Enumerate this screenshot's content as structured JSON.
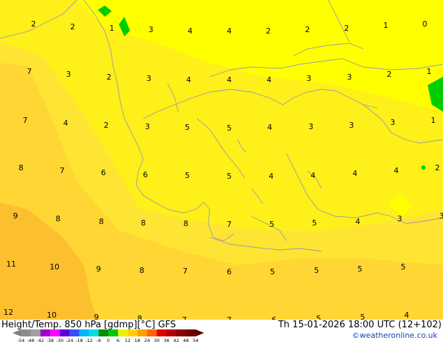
{
  "map": {
    "field_colors": {
      "yellow_bright": "#ffff00",
      "yellow": "#fff01a",
      "yellow_orange": "#ffe533",
      "light_orange": "#ffd633",
      "orange": "#fcc02e",
      "green": "#00cc00",
      "border": "#9a9aa8"
    },
    "labels": [
      "2",
      "2",
      "1",
      "3",
      "4",
      "4",
      "2",
      "2",
      "2",
      "1",
      "0",
      "7",
      "3",
      "2",
      "3",
      "4",
      "4",
      "4",
      "3",
      "3",
      "2",
      "1",
      "7",
      "4",
      "2",
      "3",
      "5",
      "5",
      "4",
      "3",
      "3",
      "3",
      "1",
      "8",
      "7",
      "6",
      "6",
      "5",
      "5",
      "4",
      "4",
      "4",
      "4",
      "2",
      "9",
      "8",
      "8",
      "8",
      "8",
      "7",
      "5",
      "5",
      "4",
      "3",
      "3",
      "11",
      "10",
      "9",
      "8",
      "7",
      "6",
      "5",
      "5",
      "5",
      "5",
      "12",
      "10",
      "9",
      "8",
      "7",
      "7",
      "6",
      "5",
      "5",
      "4"
    ]
  },
  "footer": {
    "title": "Height/Temp. 850 hPa [gdmp][°C] GFS",
    "datetime": "Th 15-01-2026 18:00 UTC (12+102)",
    "credit": "©weatheronline.co.uk",
    "scale_ticks": [
      "-54",
      "-48",
      "-42",
      "-38",
      "-30",
      "-24",
      "-18",
      "-12",
      "-6",
      "0",
      "6",
      "12",
      "18",
      "24",
      "30",
      "36",
      "42",
      "48",
      "54"
    ],
    "scale_colors": [
      "#8c8c8c",
      "#a0a0a0",
      "#a000c8",
      "#ff00ff",
      "#6000d0",
      "#3050ff",
      "#00b4ff",
      "#00e0e0",
      "#008c00",
      "#00c800",
      "#f0f000",
      "#ffd000",
      "#ffa000",
      "#ff6400",
      "#e00000",
      "#b40000",
      "#8c0000",
      "#6e0000"
    ]
  }
}
